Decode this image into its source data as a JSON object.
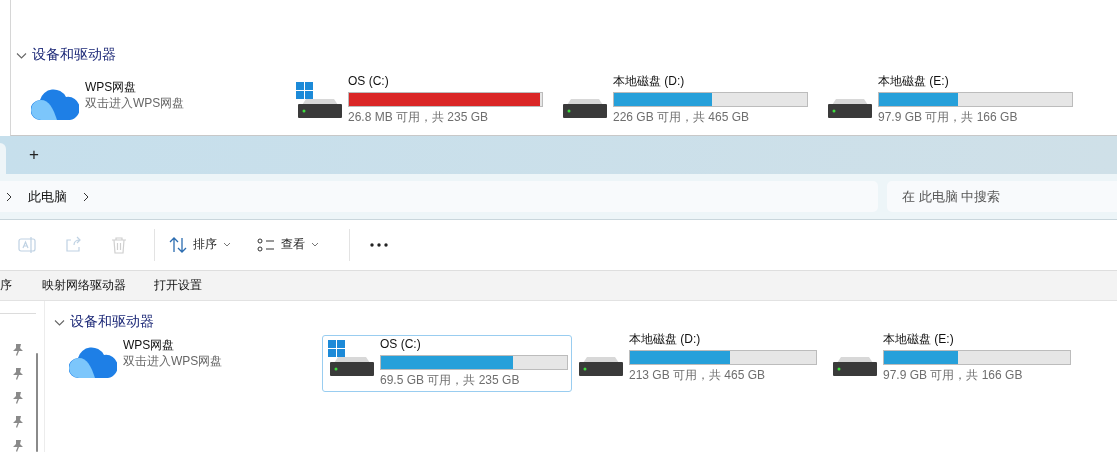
{
  "top_panel": {
    "section": {
      "title": "设备和驱动器",
      "expanded": true
    },
    "items": [
      {
        "kind": "cloud",
        "name": "WPS网盘",
        "subtitle": "双击进入WPS网盘"
      },
      {
        "kind": "drive",
        "name": "OS (C:)",
        "system": true,
        "level": 0.99,
        "low_space": true,
        "usage": "26.8 MB 可用，共 235 GB",
        "selected": false
      },
      {
        "kind": "drive",
        "name": "本地磁盘 (D:)",
        "system": false,
        "level": 0.51,
        "low_space": false,
        "usage": "226 GB 可用，共 465 GB",
        "selected": false
      },
      {
        "kind": "drive",
        "name": "本地磁盘 (E:)",
        "system": false,
        "level": 0.41,
        "low_space": false,
        "usage": "97.9 GB 可用，共 166 GB",
        "selected": false
      }
    ]
  },
  "window": {
    "tab_bar": {
      "new_tab": "+"
    },
    "address_bar": {
      "path": [
        "此电脑"
      ]
    },
    "search": {
      "placeholder": "在 此电脑 中搜索"
    },
    "toolbar": [
      {
        "kind": "rename",
        "disabled": true
      },
      {
        "kind": "share",
        "disabled": true
      },
      {
        "kind": "delete",
        "disabled": true
      },
      {
        "kind": "separator"
      },
      {
        "kind": "sort",
        "label": "排序"
      },
      {
        "kind": "view",
        "label": "查看"
      },
      {
        "kind": "separator"
      },
      {
        "kind": "more"
      }
    ],
    "commands": [
      "序",
      "映射网络驱动器",
      "打开设置"
    ],
    "content": {
      "section": {
        "title": "设备和驱动器",
        "expanded": true
      },
      "items": [
        {
          "kind": "cloud",
          "name": "WPS网盘",
          "subtitle": "双击进入WPS网盘"
        },
        {
          "kind": "drive",
          "name": "OS (C:)",
          "system": true,
          "level": 0.71,
          "low_space": false,
          "usage": "69.5 GB 可用，共 235 GB",
          "selected": true
        },
        {
          "kind": "drive",
          "name": "本地磁盘 (D:)",
          "system": false,
          "level": 0.54,
          "low_space": false,
          "usage": "213 GB 可用，共 465 GB",
          "selected": false
        },
        {
          "kind": "drive",
          "name": "本地磁盘 (E:)",
          "system": false,
          "level": 0.4,
          "low_space": false,
          "usage": "97.9 GB 可用，共 166 GB",
          "selected": false
        }
      ]
    }
  }
}
